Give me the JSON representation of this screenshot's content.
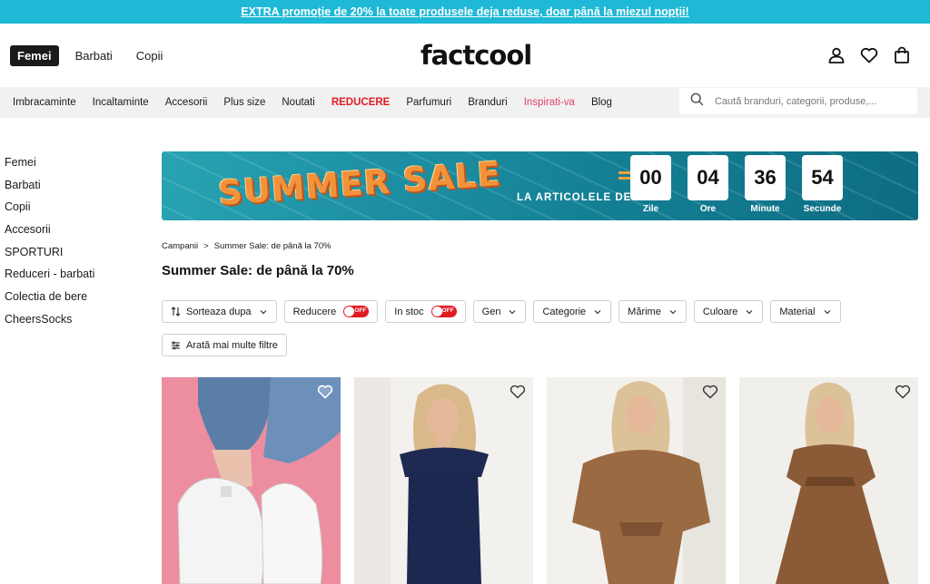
{
  "promo": {
    "text": "EXTRA promoție de 20% la toate produsele deja reduse, doar până la miezul nopții!"
  },
  "header": {
    "gender_tabs": [
      "Femei",
      "Barbati",
      "Copii"
    ],
    "logo": "factcool",
    "icons": [
      "user-icon",
      "heart-icon",
      "bag-icon"
    ]
  },
  "nav": {
    "items": [
      "Imbracaminte",
      "Incaltaminte",
      "Accesorii",
      "Plus size",
      "Noutati",
      "REDUCERE",
      "Parfumuri",
      "Branduri",
      "Inspirati-va",
      "Blog"
    ],
    "search_placeholder": "Caută branduri, categorii, produse,..."
  },
  "sidebar": {
    "items": [
      "Femei",
      "Barbati",
      "Copii",
      "Accesorii",
      "SPORTURI",
      "Reduceri - barbati",
      "Colectia de bere",
      "CheersSocks"
    ]
  },
  "hero": {
    "title": "SUMMER SALE",
    "subtitle": "LA ARTICOLELE DE VARĂ",
    "timer": [
      {
        "value": "00",
        "label": "Zile"
      },
      {
        "value": "04",
        "label": "Ore"
      },
      {
        "value": "36",
        "label": "Minute"
      },
      {
        "value": "54",
        "label": "Secunde"
      }
    ]
  },
  "breadcrumb": {
    "items": [
      "Campanii",
      "Summer Sale: de până la 70%"
    ],
    "separator": ">"
  },
  "page_title": "Summer Sale: de până la 70%",
  "filters": {
    "sort": "Sorteaza dupa",
    "discount": "Reducere",
    "in_stock": "In stoc",
    "toggle_off": "OFF",
    "dropdowns": [
      "Gen",
      "Categorie",
      "Mărime",
      "Culoare",
      "Material"
    ],
    "more": "Arată mai multe filtre"
  },
  "colors": {
    "promo": "#1fb8d6",
    "sale": "#e01b24",
    "inspire": "#e0456b",
    "accent_orange": "#f2923a"
  }
}
